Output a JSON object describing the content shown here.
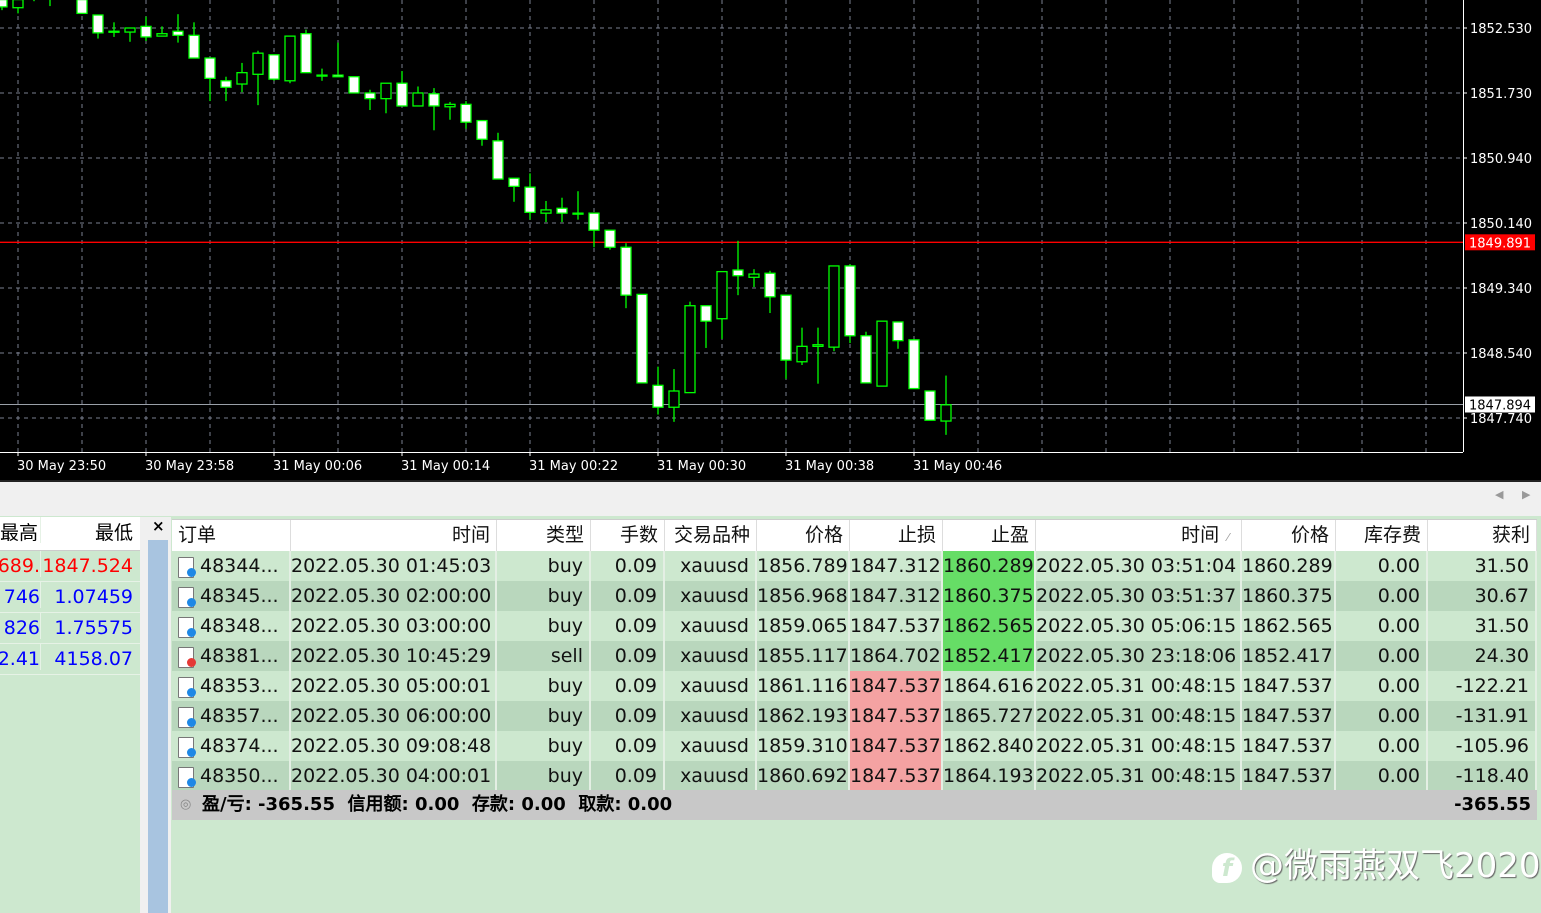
{
  "chart": {
    "type": "candlestick",
    "price_labels": [
      "1852.530",
      "1851.730",
      "1850.940",
      "1850.140",
      "1849.340",
      "1848.540",
      "1847.740"
    ],
    "time_labels": [
      "30 May 23:50",
      "30 May 23:58",
      "31 May 00:06",
      "31 May 00:14",
      "31 May 00:22",
      "31 May 00:30",
      "31 May 00:38",
      "31 May 00:46"
    ],
    "red_line": {
      "price": 1849.891,
      "label": "1849.891",
      "color": "#ff0000"
    },
    "bid_line": {
      "price": 1847.894,
      "label": "1847.894"
    },
    "bull_color": "#00ff00",
    "candles": [
      [
        1852.88,
        1852.91,
        1852.75,
        1852.79
      ],
      [
        1852.78,
        1852.9,
        1852.71,
        1852.88
      ],
      [
        1852.95,
        1852.98,
        1852.86,
        1852.91
      ],
      [
        1852.91,
        1853.0,
        1852.8,
        1852.97
      ],
      [
        1853.0,
        1853.02,
        1852.9,
        1852.92
      ],
      [
        1852.88,
        1852.91,
        1852.71,
        1852.71
      ],
      [
        1852.69,
        1852.69,
        1852.4,
        1852.47
      ],
      [
        1852.49,
        1852.6,
        1852.42,
        1852.49
      ],
      [
        1852.48,
        1852.53,
        1852.36,
        1852.53
      ],
      [
        1852.55,
        1852.67,
        1852.37,
        1852.42
      ],
      [
        1852.43,
        1852.55,
        1852.43,
        1852.46
      ],
      [
        1852.49,
        1852.7,
        1852.35,
        1852.44
      ],
      [
        1852.44,
        1852.6,
        1852.16,
        1852.16
      ],
      [
        1852.16,
        1852.16,
        1851.63,
        1851.91
      ],
      [
        1851.88,
        1851.93,
        1851.63,
        1851.8
      ],
      [
        1851.84,
        1852.1,
        1851.74,
        1851.98
      ],
      [
        1851.96,
        1852.25,
        1851.58,
        1852.22
      ],
      [
        1852.2,
        1852.2,
        1851.88,
        1851.9
      ],
      [
        1851.88,
        1852.43,
        1851.85,
        1852.43
      ],
      [
        1852.46,
        1852.51,
        1851.98,
        1851.98
      ],
      [
        1851.95,
        1852.03,
        1851.88,
        1851.95
      ],
      [
        1851.95,
        1852.35,
        1851.93,
        1851.93
      ],
      [
        1851.93,
        1851.93,
        1851.73,
        1851.73
      ],
      [
        1851.73,
        1851.77,
        1851.52,
        1851.66
      ],
      [
        1851.66,
        1851.85,
        1851.48,
        1851.85
      ],
      [
        1851.85,
        1852.0,
        1851.57,
        1851.57
      ],
      [
        1851.57,
        1851.81,
        1851.57,
        1851.73
      ],
      [
        1851.72,
        1851.79,
        1851.27,
        1851.57
      ],
      [
        1851.56,
        1851.62,
        1851.4,
        1851.59
      ],
      [
        1851.59,
        1851.63,
        1851.29,
        1851.37
      ],
      [
        1851.39,
        1851.39,
        1851.08,
        1851.16
      ],
      [
        1851.14,
        1851.24,
        1850.67,
        1850.67
      ],
      [
        1850.68,
        1850.68,
        1850.39,
        1850.58
      ],
      [
        1850.57,
        1850.74,
        1850.17,
        1850.26
      ],
      [
        1850.25,
        1850.4,
        1850.14,
        1850.29
      ],
      [
        1850.31,
        1850.44,
        1850.14,
        1850.25
      ],
      [
        1850.25,
        1850.52,
        1850.17,
        1850.25
      ],
      [
        1850.25,
        1850.25,
        1849.83,
        1850.04
      ],
      [
        1850.04,
        1850.04,
        1849.8,
        1849.83
      ],
      [
        1849.83,
        1849.88,
        1849.08,
        1849.24
      ],
      [
        1849.25,
        1849.25,
        1848.16,
        1848.16
      ],
      [
        1848.13,
        1848.36,
        1847.77,
        1847.86
      ],
      [
        1847.86,
        1848.33,
        1847.68,
        1848.06
      ],
      [
        1848.04,
        1849.16,
        1848.04,
        1849.11
      ],
      [
        1849.11,
        1849.11,
        1848.59,
        1848.92
      ],
      [
        1848.95,
        1849.53,
        1848.7,
        1849.53
      ],
      [
        1849.55,
        1849.91,
        1849.24,
        1849.48
      ],
      [
        1849.46,
        1849.56,
        1849.34,
        1849.5
      ],
      [
        1849.51,
        1849.54,
        1849.02,
        1849.22
      ],
      [
        1849.24,
        1849.24,
        1848.21,
        1848.44
      ],
      [
        1848.42,
        1848.84,
        1848.38,
        1848.61
      ],
      [
        1848.61,
        1848.84,
        1848.15,
        1848.63
      ],
      [
        1848.6,
        1849.6,
        1848.55,
        1849.6
      ],
      [
        1849.6,
        1849.62,
        1848.65,
        1848.74
      ],
      [
        1848.74,
        1848.79,
        1848.16,
        1848.16
      ],
      [
        1848.12,
        1848.92,
        1848.12,
        1848.92
      ],
      [
        1848.91,
        1848.91,
        1848.58,
        1848.68
      ],
      [
        1848.69,
        1848.7,
        1848.09,
        1848.09
      ],
      [
        1848.06,
        1848.06,
        1847.7,
        1847.7
      ],
      [
        1847.69,
        1848.25,
        1847.52,
        1847.89
      ]
    ]
  },
  "toolbar": {
    "scroll_left": "◀",
    "scroll_right": "▶"
  },
  "market_watch": {
    "headers": [
      "最高",
      "最低"
    ],
    "rows": [
      {
        "high": ".689",
        "low": "1847.524",
        "color": "#ff0000"
      },
      {
        "high": "746",
        "low": "1.07459",
        "color": "#0000ff"
      },
      {
        "high": "826",
        "low": "1.75575",
        "color": "#0000ff"
      },
      {
        "high": "2.41",
        "low": "4158.07",
        "color": "#0000ff"
      }
    ]
  },
  "close_label": "×",
  "orders": {
    "headers": [
      "订单",
      "时间",
      "类型",
      "手数",
      "交易品种",
      "价格",
      "止损",
      "止盈",
      "时间",
      "价格",
      "库存费",
      "获利"
    ],
    "sort_indicator": "⁄",
    "rows": [
      {
        "order": "48344...",
        "open_time": "2022.05.30 01:45:03",
        "type": "buy",
        "lots": "0.09",
        "symbol": "xauusd",
        "price": "1856.789",
        "sl": "1847.312",
        "tp": "1860.289",
        "close_time": "2022.05.30 03:51:04",
        "close_price": "1860.289",
        "swap": "0.00",
        "profit": "31.50",
        "hit": "tp"
      },
      {
        "order": "48345...",
        "open_time": "2022.05.30 02:00:00",
        "type": "buy",
        "lots": "0.09",
        "symbol": "xauusd",
        "price": "1856.968",
        "sl": "1847.312",
        "tp": "1860.375",
        "close_time": "2022.05.30 03:51:37",
        "close_price": "1860.375",
        "swap": "0.00",
        "profit": "30.67",
        "hit": "tp"
      },
      {
        "order": "48348...",
        "open_time": "2022.05.30 03:00:00",
        "type": "buy",
        "lots": "0.09",
        "symbol": "xauusd",
        "price": "1859.065",
        "sl": "1847.537",
        "tp": "1862.565",
        "close_time": "2022.05.30 05:06:15",
        "close_price": "1862.565",
        "swap": "0.00",
        "profit": "31.50",
        "hit": "tp"
      },
      {
        "order": "48381...",
        "open_time": "2022.05.30 10:45:29",
        "type": "sell",
        "lots": "0.09",
        "symbol": "xauusd",
        "price": "1855.117",
        "sl": "1864.702",
        "tp": "1852.417",
        "close_time": "2022.05.30 23:18:06",
        "close_price": "1852.417",
        "swap": "0.00",
        "profit": "24.30",
        "hit": "tp"
      },
      {
        "order": "48353...",
        "open_time": "2022.05.30 05:00:01",
        "type": "buy",
        "lots": "0.09",
        "symbol": "xauusd",
        "price": "1861.116",
        "sl": "1847.537",
        "tp": "1864.616",
        "close_time": "2022.05.31 00:48:15",
        "close_price": "1847.537",
        "swap": "0.00",
        "profit": "-122.21",
        "hit": "sl"
      },
      {
        "order": "48357...",
        "open_time": "2022.05.30 06:00:00",
        "type": "buy",
        "lots": "0.09",
        "symbol": "xauusd",
        "price": "1862.193",
        "sl": "1847.537",
        "tp": "1865.727",
        "close_time": "2022.05.31 00:48:15",
        "close_price": "1847.537",
        "swap": "0.00",
        "profit": "-131.91",
        "hit": "sl"
      },
      {
        "order": "48374...",
        "open_time": "2022.05.30 09:08:48",
        "type": "buy",
        "lots": "0.09",
        "symbol": "xauusd",
        "price": "1859.310",
        "sl": "1847.537",
        "tp": "1862.840",
        "close_time": "2022.05.31 00:48:15",
        "close_price": "1847.537",
        "swap": "0.00",
        "profit": "-105.96",
        "hit": "sl"
      },
      {
        "order": "48350...",
        "open_time": "2022.05.30 04:00:01",
        "type": "buy",
        "lots": "0.09",
        "symbol": "xauusd",
        "price": "1860.692",
        "sl": "1847.537",
        "tp": "1864.193",
        "close_time": "2022.05.31 00:48:15",
        "close_price": "1847.537",
        "swap": "0.00",
        "profit": "-118.40",
        "hit": "sl"
      }
    ],
    "summary": {
      "text": "盈/亏: -365.55  信用额: 0.00  存款: 0.00  取款: 0.00",
      "total": "-365.55"
    }
  },
  "watermark": "@微雨燕双飞2020"
}
